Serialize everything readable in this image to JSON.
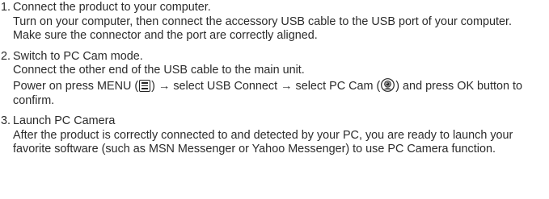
{
  "steps": [
    {
      "number": "1.",
      "title": "Connect the product to your computer.",
      "lines": [
        "Turn on your computer, then connect the accessory USB cable to the USB port of your computer.",
        "Make sure the connector and the port are correctly aligned."
      ]
    },
    {
      "number": "2.",
      "title": "Switch to PC Cam mode.",
      "line1": "Connect the other end of the USB cable to the main unit.",
      "line2_part1": "Power on press MENU (",
      "line2_part2": ") → select USB Connect → select PC Cam (",
      "line2_part3": ") and press OK button to confirm.",
      "icons": [
        "menu-icon",
        "webcam-icon"
      ]
    },
    {
      "number": "3.",
      "title": "Launch PC Camera",
      "lines": [
        "After the product is correctly connected to and detected by your PC, you are ready to launch your favorite software (such as MSN Messenger or Yahoo Messenger) to use PC Camera function."
      ]
    }
  ]
}
